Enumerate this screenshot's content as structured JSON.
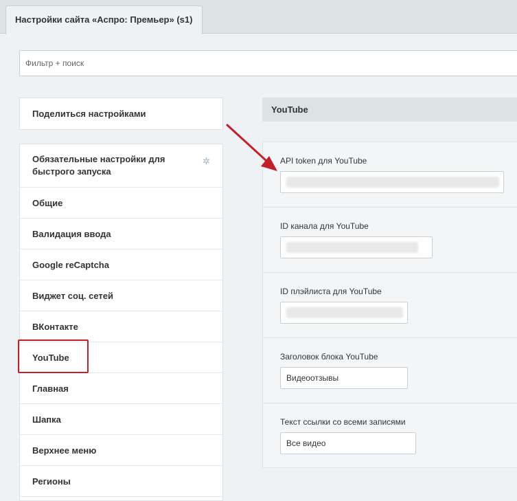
{
  "tab": {
    "title": "Настройки сайта «Аспро: Премьер» (s1)"
  },
  "filter": {
    "placeholder": "Фильтр + поиск"
  },
  "sidebar": {
    "share_label": "Поделиться настройками",
    "items": [
      {
        "label": "Обязательные настройки для быстрого запуска",
        "starred": true
      },
      {
        "label": "Общие"
      },
      {
        "label": "Валидация ввода"
      },
      {
        "label": "Google reCaptcha"
      },
      {
        "label": "Виджет соц. сетей"
      },
      {
        "label": "ВКонтакте"
      },
      {
        "label": "YouTube",
        "active": true
      },
      {
        "label": "Главная"
      },
      {
        "label": "Шапка"
      },
      {
        "label": "Верхнее меню"
      },
      {
        "label": "Регионы"
      }
    ],
    "star_icon": "star-icon"
  },
  "section": {
    "title": "YouTube",
    "fields": [
      {
        "label": "API token для YouTube",
        "value": ""
      },
      {
        "label": "ID канала для YouTube",
        "value": ""
      },
      {
        "label": "ID плэйлиста для YouTube",
        "value": ""
      },
      {
        "label": "Заголовок блока YouTube",
        "value": "Видеоотзывы"
      },
      {
        "label": "Текст ссылки со всеми записями",
        "value": "Все видео"
      }
    ]
  },
  "colors": {
    "annotation": "#c21f2b",
    "accent_star": "#9db5c9"
  }
}
